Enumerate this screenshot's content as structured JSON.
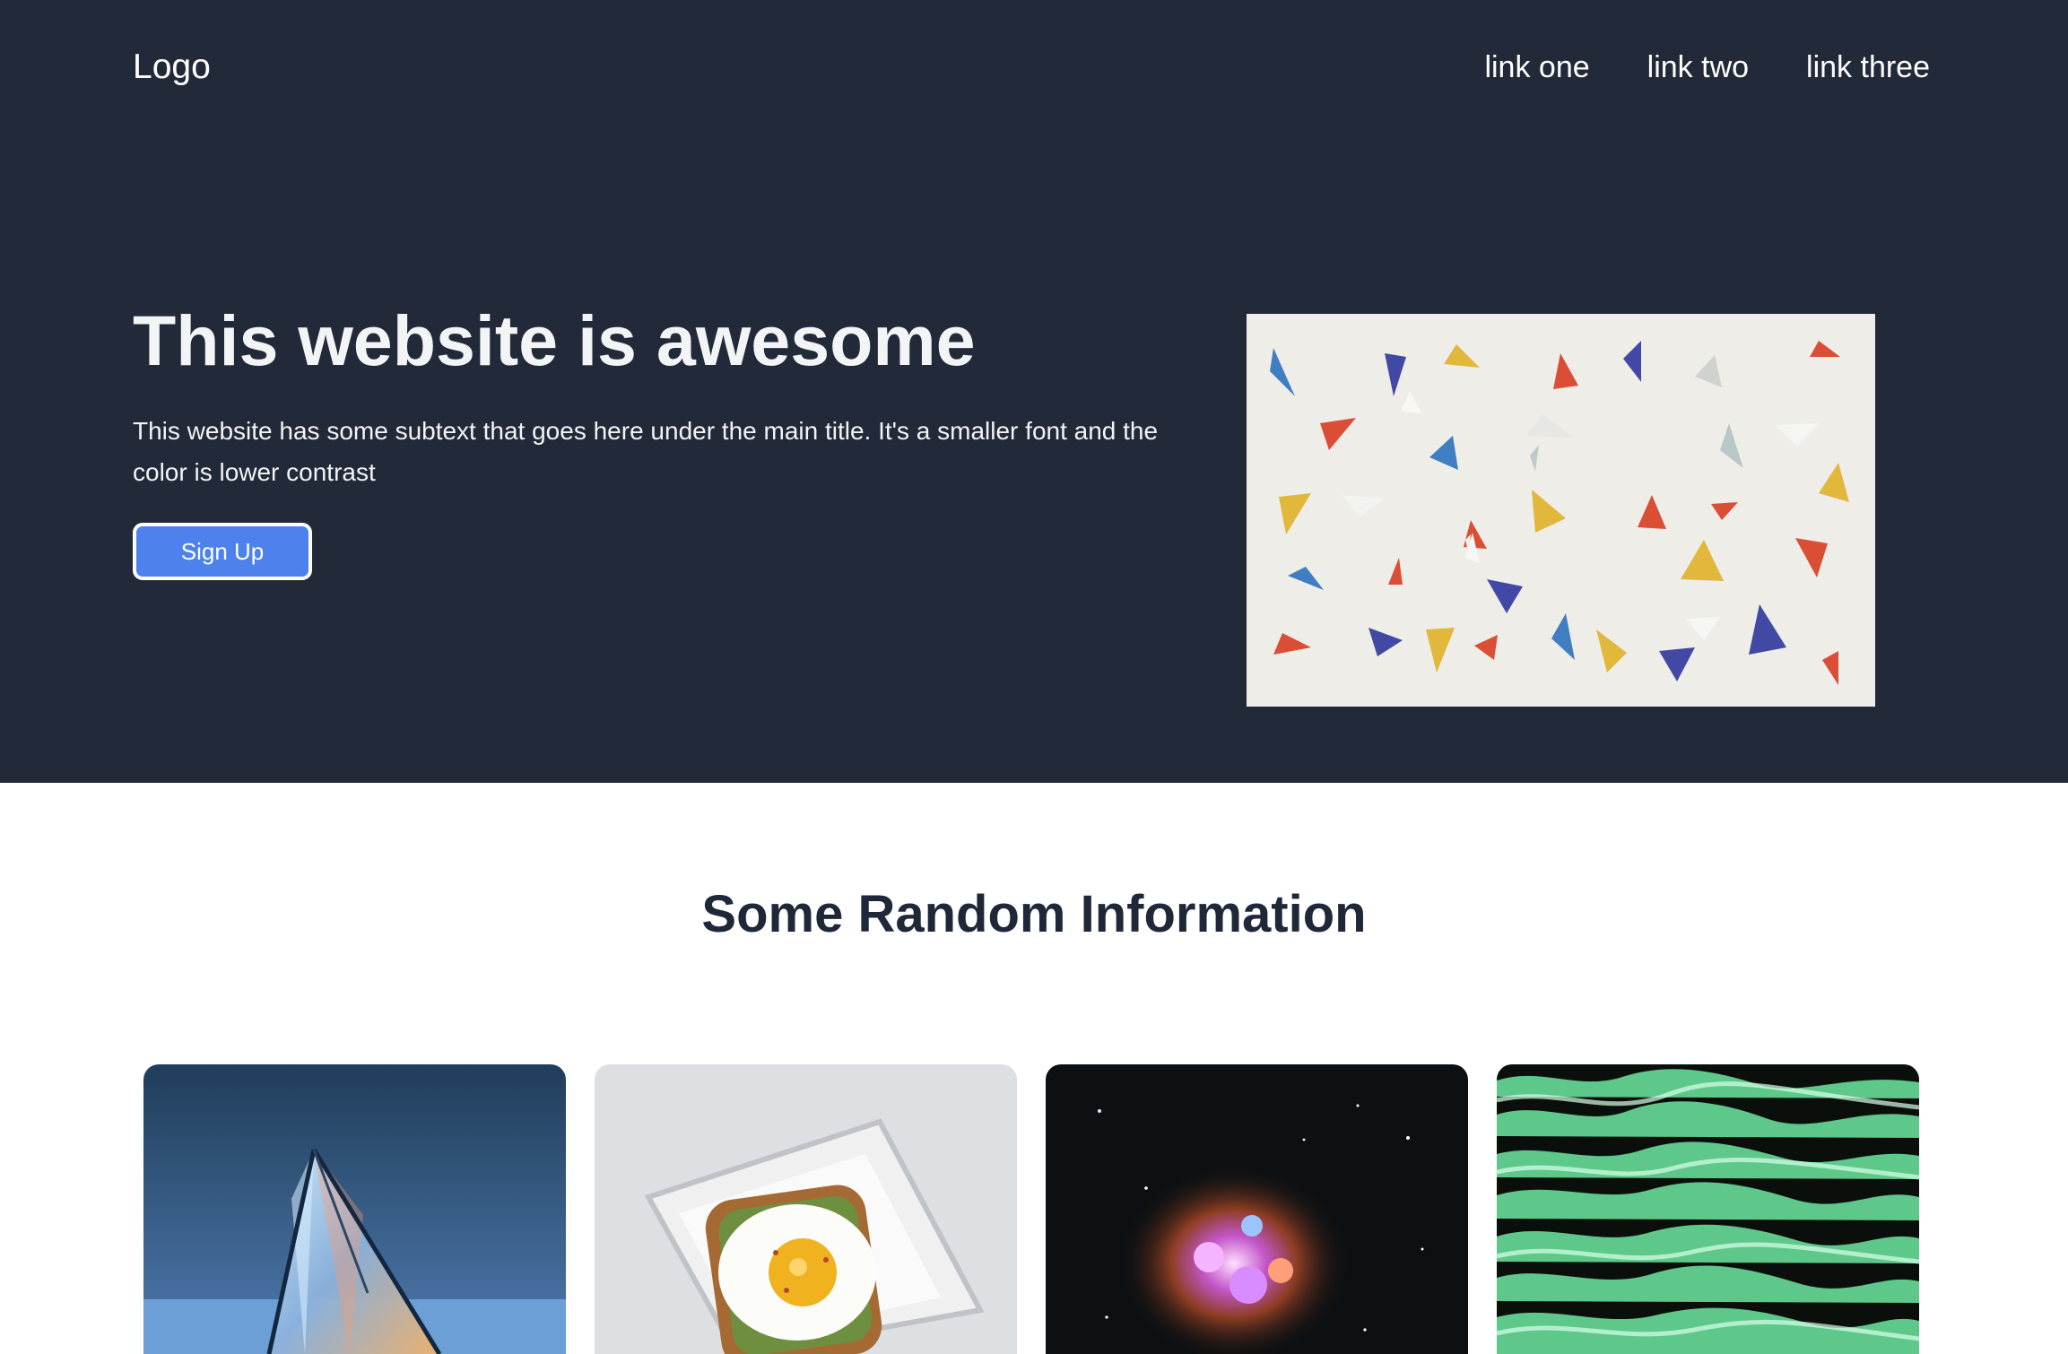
{
  "header": {
    "logo": "Logo",
    "nav": [
      "link one",
      "link two",
      "link three"
    ]
  },
  "hero": {
    "title": "This website is awesome",
    "subtitle": "This website has some subtext that goes here under the main title. It's a smaller font and the color is lower contrast",
    "cta_label": "Sign Up",
    "image_alt": "colorful paper triangles on white background"
  },
  "section": {
    "title": "Some Random Information"
  },
  "cards": [
    {
      "image": "glass prism"
    },
    {
      "image": "egg on toast on plate"
    },
    {
      "image": "nebula in space"
    },
    {
      "image": "green water ripples"
    }
  ],
  "colors": {
    "hero_bg": "#222938",
    "button": "#4d82ec",
    "heading": "#1f2838"
  }
}
